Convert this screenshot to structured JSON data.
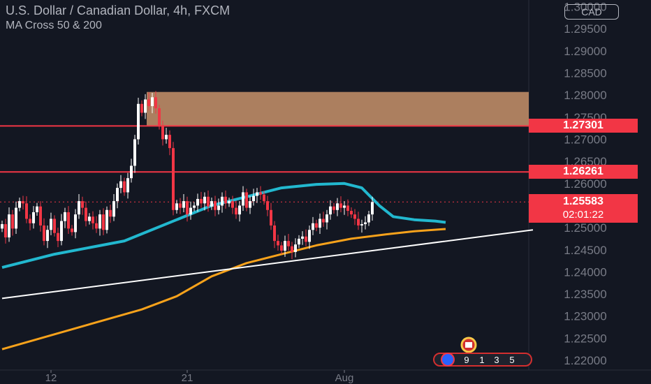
{
  "legend": {
    "title": "U.S. Dollar / Canadian Dollar, 4h, FXCM",
    "indicator": "MA Cross 50 & 200"
  },
  "currency_button": "CAD",
  "countdown": "02:01:22",
  "event_badge_digits": [
    "9",
    "1",
    "3",
    "5"
  ],
  "colors": {
    "background": "#131722",
    "up_candle": "#ffffff",
    "down_candle": "#f23645",
    "ma50": "#22b8cf",
    "ma200": "#f7a21b",
    "trendline": "#ffffff",
    "zone": "#c8926a",
    "level_line": "#f23645",
    "axis_text": "#787b86"
  },
  "chart_data": {
    "type": "candlestick",
    "title": "U.S. Dollar / Canadian Dollar, 4h, FXCM",
    "xlabel": "",
    "ylabel": "",
    "ylim": [
      1.2178,
      1.3015
    ],
    "x_ticks": [
      "12",
      "21",
      "Aug"
    ],
    "y_ticks": [
      1.22,
      1.225,
      1.23,
      1.235,
      1.24,
      1.245,
      1.25,
      1.255,
      1.26,
      1.265,
      1.27,
      1.275,
      1.28,
      1.285,
      1.29,
      1.295,
      1.3
    ],
    "y_tick_labels": [
      "1.22000",
      "1.22500",
      "1.23000",
      "1.23500",
      "1.24000",
      "1.24500",
      "1.25000",
      "1.25500",
      "1.26000",
      "1.26500",
      "1.27000",
      "1.27500",
      "1.28000",
      "1.28500",
      "1.29000",
      "1.29500",
      "1.30000"
    ],
    "levels": [
      {
        "label": "1.27301",
        "price": 1.27301
      },
      {
        "label": "1.26261",
        "price": 1.26261
      }
    ],
    "current_price": {
      "label": "1.25583",
      "price": 1.25583
    },
    "supply_zone": {
      "price_low": 1.273,
      "price_high": 1.2807
    },
    "close_series": [
      1.2508,
      1.2478,
      1.253,
      1.2498,
      1.2545,
      1.256,
      1.2555,
      1.252,
      1.251,
      1.2535,
      1.2548,
      1.2505,
      1.247,
      1.2495,
      1.252,
      1.2488,
      1.247,
      1.2515,
      1.2535,
      1.2498,
      1.249,
      1.253,
      1.256,
      1.2545,
      1.2515,
      1.2525,
      1.251,
      1.2498,
      1.253,
      1.2495,
      1.254,
      1.2525,
      1.256,
      1.259,
      1.2605,
      1.258,
      1.2612,
      1.264,
      1.27,
      1.278,
      1.276,
      1.279,
      1.2775,
      1.2795,
      1.277,
      1.273,
      1.27,
      1.271,
      1.268,
      1.254,
      1.2555,
      1.2545,
      1.256,
      1.253,
      1.2545,
      1.255,
      1.2565,
      1.2555,
      1.257,
      1.2548,
      1.256,
      1.254,
      1.255,
      1.257,
      1.2555,
      1.256,
      1.2545,
      1.253,
      1.255,
      1.258,
      1.2545,
      1.256,
      1.2572,
      1.258,
      1.2575,
      1.256,
      1.254,
      1.2505,
      1.247,
      1.246,
      1.2448,
      1.247,
      1.2458,
      1.2445,
      1.2462,
      1.2475,
      1.248,
      1.2468,
      1.2495,
      1.251,
      1.25,
      1.252,
      1.2512,
      1.253,
      1.2548,
      1.254,
      1.2555,
      1.2545,
      1.255,
      1.2538,
      1.253,
      1.252,
      1.2505,
      1.2508,
      1.2512,
      1.253,
      1.2558
    ],
    "series": [
      {
        "name": "MA 50",
        "points": [
          [
            0,
            1.241
          ],
          [
            15,
            1.244
          ],
          [
            35,
            1.247
          ],
          [
            50,
            1.2518
          ],
          [
            60,
            1.255
          ],
          [
            70,
            1.257
          ],
          [
            80,
            1.259
          ],
          [
            90,
            1.2598
          ],
          [
            98,
            1.26
          ],
          [
            103,
            1.259
          ],
          [
            108,
            1.255
          ],
          [
            112,
            1.2525
          ],
          [
            118,
            1.2518
          ],
          [
            124,
            1.2515
          ],
          [
            127,
            1.2512
          ]
        ]
      },
      {
        "name": "MA 200",
        "points": [
          [
            0,
            1.2225
          ],
          [
            20,
            1.227
          ],
          [
            40,
            1.2315
          ],
          [
            50,
            1.2345
          ],
          [
            60,
            1.239
          ],
          [
            70,
            1.242
          ],
          [
            80,
            1.244
          ],
          [
            90,
            1.246
          ],
          [
            100,
            1.2475
          ],
          [
            110,
            1.2485
          ],
          [
            118,
            1.2492
          ],
          [
            127,
            1.2497
          ]
        ]
      },
      {
        "name": "Trendline",
        "points": [
          [
            0,
            1.234
          ],
          [
            152,
            1.2495
          ]
        ]
      }
    ]
  }
}
